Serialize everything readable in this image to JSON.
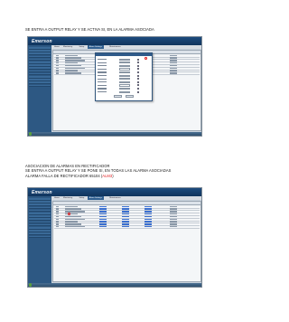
{
  "captions": {
    "first": "SE ENTRA A OUTPUT RELAY Y SE ACTIVA SI, EN LA ALARMA ASOCIADA",
    "second_line1": "ASOCIACION DE ALARMAS EN RECTIFICADOR",
    "second_line2": "SE ENTRA A OUTPUT RELAY Y SE PONE SI, EN TODAS LAS ALARMA ASOCIADAS",
    "second_line3_prefix": "ALARMA FALLA DE RECTIFICADOR 65104 (",
    "second_line3_highlight": "ALM3",
    "second_line3_suffix": ")"
  },
  "screenshots": {
    "logo": "Emerson",
    "menu_tabs": [
      "Home",
      "Monitoring",
      "Setup",
      "Alarm Settings",
      "Maintenance"
    ],
    "active_tab_index": 3
  },
  "colors": {
    "highlight": "#e0181b",
    "header": "#1d4b7e",
    "sidebar": "#2d5883"
  }
}
